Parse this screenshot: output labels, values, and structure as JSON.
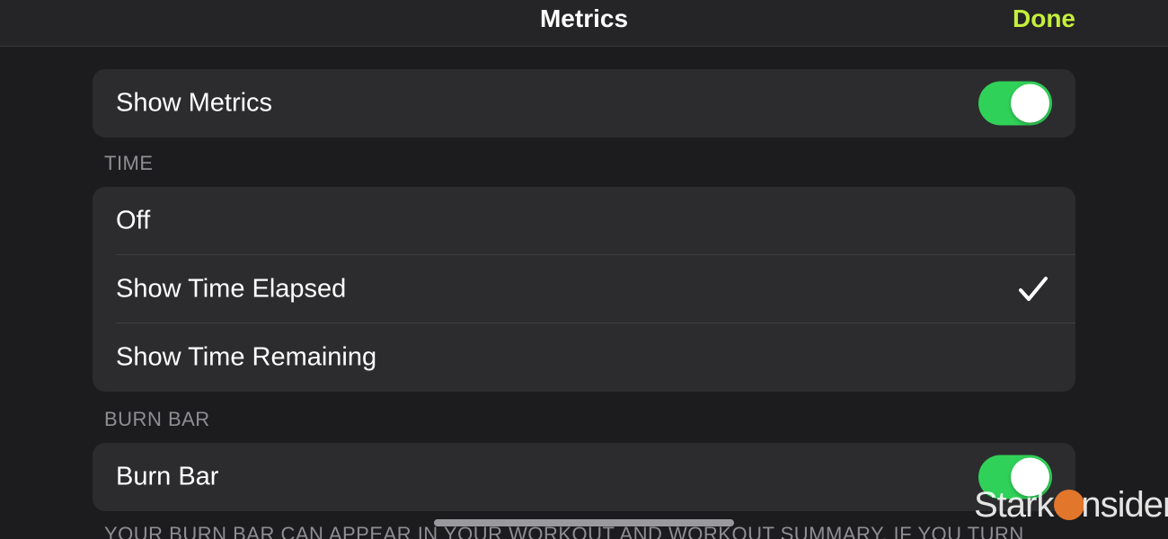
{
  "colors": {
    "accent": "#c4f03a",
    "toggle_on": "#30d158",
    "watermark_accent": "#e2762a"
  },
  "nav": {
    "title": "Metrics",
    "done_label": "Done"
  },
  "show_metrics": {
    "label": "Show Metrics",
    "toggle_on": true
  },
  "time_section": {
    "header": "TIME",
    "options": [
      {
        "label": "Off",
        "selected": false
      },
      {
        "label": "Show Time Elapsed",
        "selected": true
      },
      {
        "label": "Show Time Remaining",
        "selected": false
      }
    ],
    "selected_icon": "checkmark-icon"
  },
  "burn_bar_section": {
    "header": "BURN BAR",
    "row_label": "Burn Bar",
    "toggle_on": true,
    "footer": "YOUR BURN BAR CAN APPEAR IN YOUR WORKOUT AND WORKOUT SUMMARY. IF YOU TURN"
  },
  "watermark": {
    "part1": "Stark",
    "part2": "nsider"
  }
}
